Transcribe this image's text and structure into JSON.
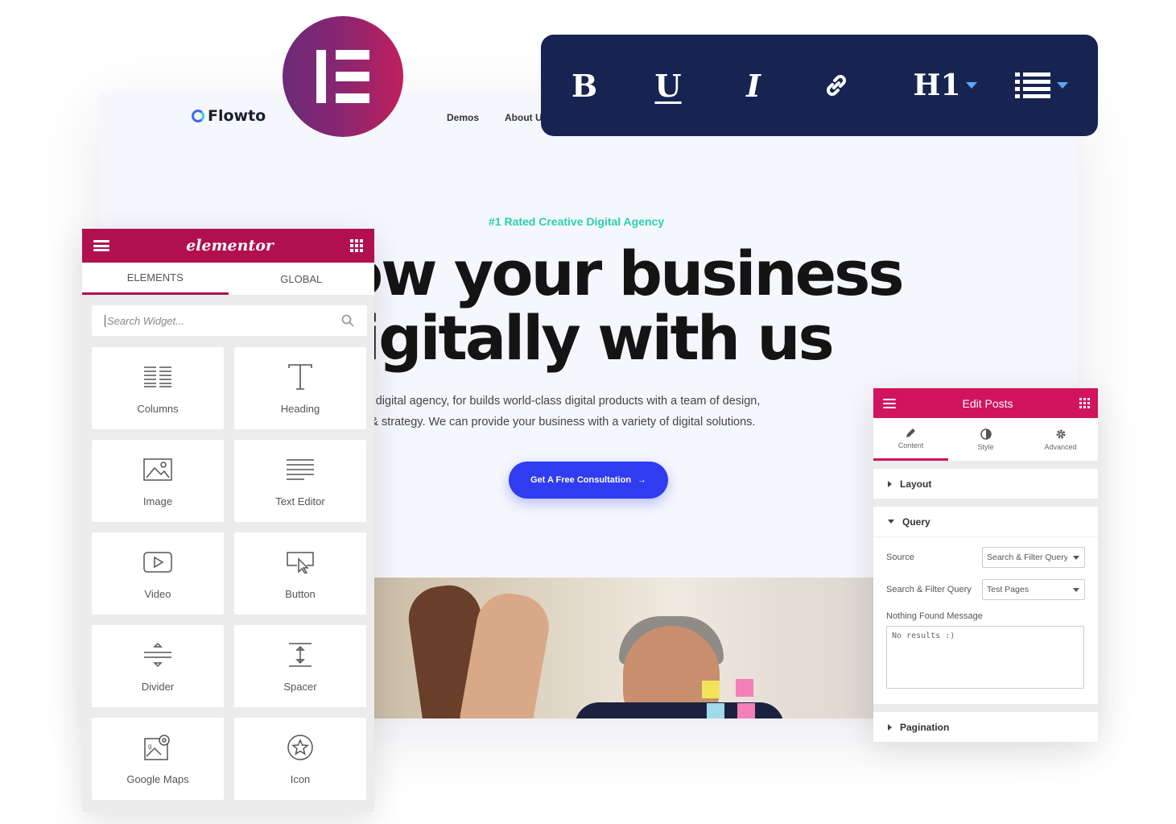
{
  "site": {
    "logo_text": "Flowto",
    "nav": [
      "Demos",
      "About U"
    ],
    "tagline": "#1 Rated Creative Digital Agency",
    "hero_title": "ow your business\nligitally with us",
    "hero_desc": "eative digital agency, for builds world-class digital products with a team of design,\nment & strategy. We can provide your business with a variety of digital solutions.",
    "cta_label": "Get A Free Consultation",
    "cta_arrow": "→",
    "tagline_color": "#27d3a8",
    "cta_color": "#2f3cf0"
  },
  "toolbar": {
    "bold": "B",
    "underline": "U",
    "italic": "I",
    "heading": "H1",
    "icons": [
      "link-icon",
      "list-icon",
      "chevron-down-icon"
    ],
    "bg_color": "#172451"
  },
  "elements_panel": {
    "brand": "elementor",
    "tabs": [
      {
        "label": "ELEMENTS",
        "active": true
      },
      {
        "label": "GLOBAL",
        "active": false
      }
    ],
    "search_placeholder": "Search Widget...",
    "widgets": [
      {
        "label": "Columns",
        "icon": "columns-icon"
      },
      {
        "label": "Heading",
        "icon": "heading-icon"
      },
      {
        "label": "Image",
        "icon": "image-icon"
      },
      {
        "label": "Text Editor",
        "icon": "text-editor-icon"
      },
      {
        "label": "Video",
        "icon": "video-icon"
      },
      {
        "label": "Button",
        "icon": "button-icon"
      },
      {
        "label": "Divider",
        "icon": "divider-icon"
      },
      {
        "label": "Spacer",
        "icon": "spacer-icon"
      },
      {
        "label": "Google Maps",
        "icon": "google-maps-icon"
      },
      {
        "label": "Icon",
        "icon": "star-icon"
      }
    ],
    "accent_color": "#b10f4e"
  },
  "edit_panel": {
    "title": "Edit Posts",
    "tabs": [
      {
        "label": "Content",
        "icon": "pencil-icon",
        "active": true
      },
      {
        "label": "Style",
        "icon": "contrast-icon",
        "active": false
      },
      {
        "label": "Advanced",
        "icon": "gear-icon",
        "active": false
      }
    ],
    "sections": {
      "layout": "Layout",
      "query": "Query",
      "pagination": "Pagination"
    },
    "source_label": "Source",
    "source_value": "Search & Filter Query",
    "sf_query_label": "Search & Filter Query",
    "sf_query_value": "Test Pages",
    "nothing_found_label": "Nothing Found Message",
    "nothing_found_value": "No results :)",
    "accent_color": "#d2135e"
  }
}
